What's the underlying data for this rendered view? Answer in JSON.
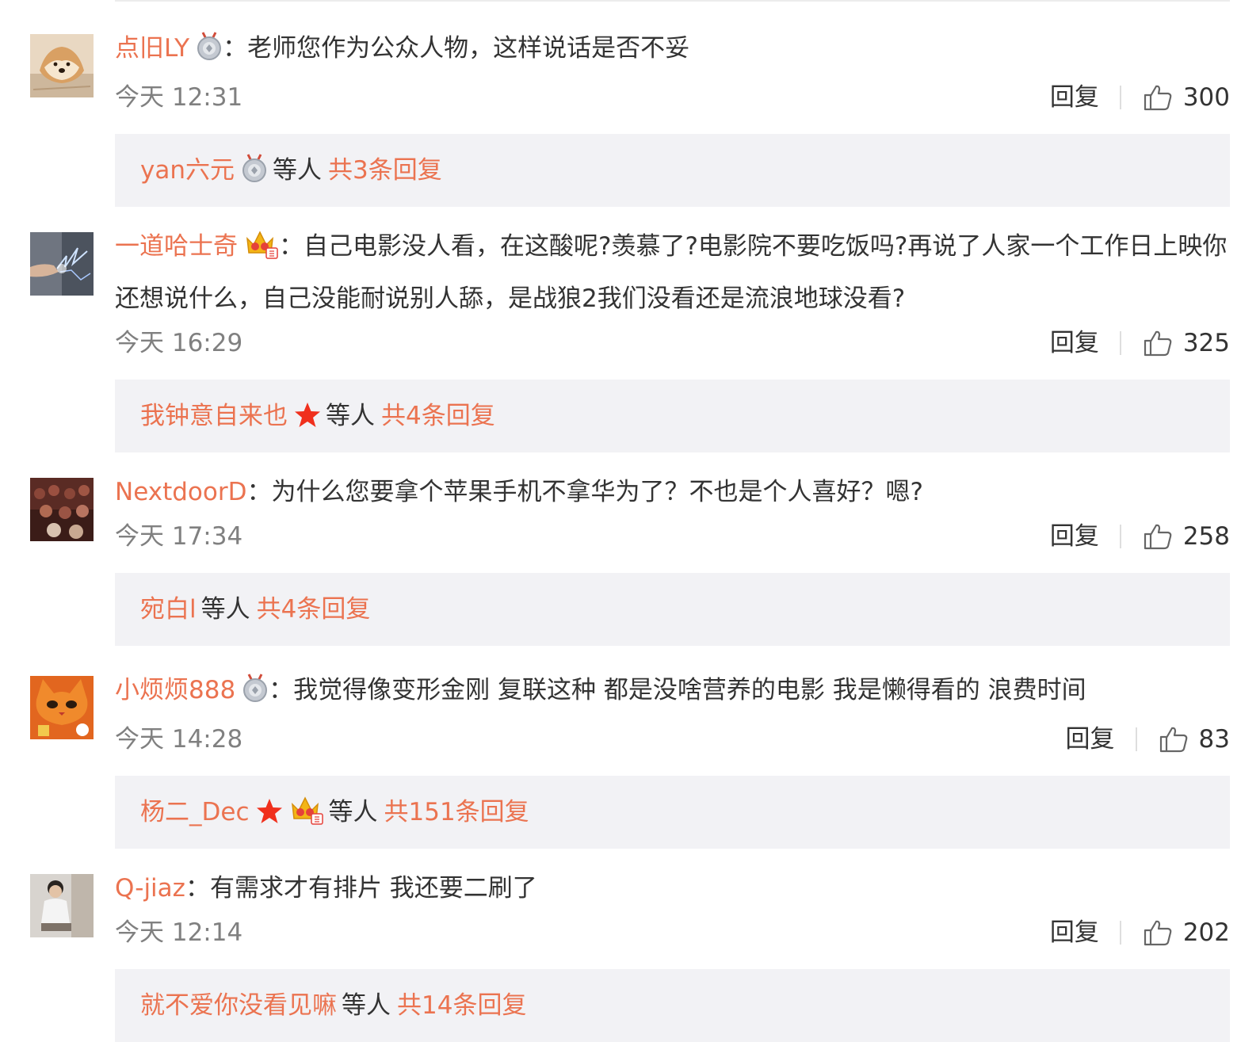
{
  "comments": [
    {
      "username": "点旧LY",
      "badges": [
        "medal-icon"
      ],
      "text": "老师您作为公众人物，这样说话是否不妥",
      "time": "今天 12:31",
      "reply_label": "回复",
      "likes": "300",
      "replies": {
        "names": "yan六元",
        "name_badges": [
          "medal-icon"
        ],
        "etc": "等人",
        "count_label": "共3条回复"
      }
    },
    {
      "username": "一道哈士奇",
      "badges": [
        "crown-icon"
      ],
      "text": "自己电影没人看，在这酸呢?羡慕了?电影院不要吃饭吗?再说了人家一个工作日上映你还想说什么，自己没能耐说别人舔，是战狼2我们没看还是流浪地球没看?",
      "time": "今天 16:29",
      "reply_label": "回复",
      "likes": "325",
      "replies": {
        "names": "我钟意自来也",
        "name_badges": [
          "star-icon"
        ],
        "etc": "等人",
        "count_label": "共4条回复"
      }
    },
    {
      "username": "NextdoorD",
      "badges": [],
      "text": "为什么您要拿个苹果手机不拿华为了？不也是个人喜好？嗯?",
      "time": "今天 17:34",
      "reply_label": "回复",
      "likes": "258",
      "replies": {
        "names": "宛白l",
        "name_badges": [],
        "etc": "等人",
        "count_label": "共4条回复"
      }
    },
    {
      "username": "小烦烦888",
      "badges": [
        "medal-icon"
      ],
      "text": "我觉得像变形金刚 复联这种 都是没啥营养的电影  我是懒得看的  浪费时间",
      "time": "今天 14:28",
      "reply_label": "回复",
      "likes": "83",
      "replies": {
        "names": "杨二_Dec",
        "name_badges": [
          "star-icon",
          "crown-icon"
        ],
        "etc": "等人",
        "count_label": "共151条回复"
      }
    },
    {
      "username": "Q-jiaz",
      "badges": [],
      "text": "有需求才有排片 我还要二刷了",
      "time": "今天 12:14",
      "reply_label": "回复",
      "likes": "202",
      "replies": {
        "names": "就不爱你没看见嘛",
        "name_badges": [],
        "etc": "等人",
        "count_label": "共14条回复"
      }
    }
  ],
  "colors": {
    "accent": "#eb7350",
    "reply_bg": "#f2f2f5",
    "time": "#808080",
    "text": "#333333"
  }
}
